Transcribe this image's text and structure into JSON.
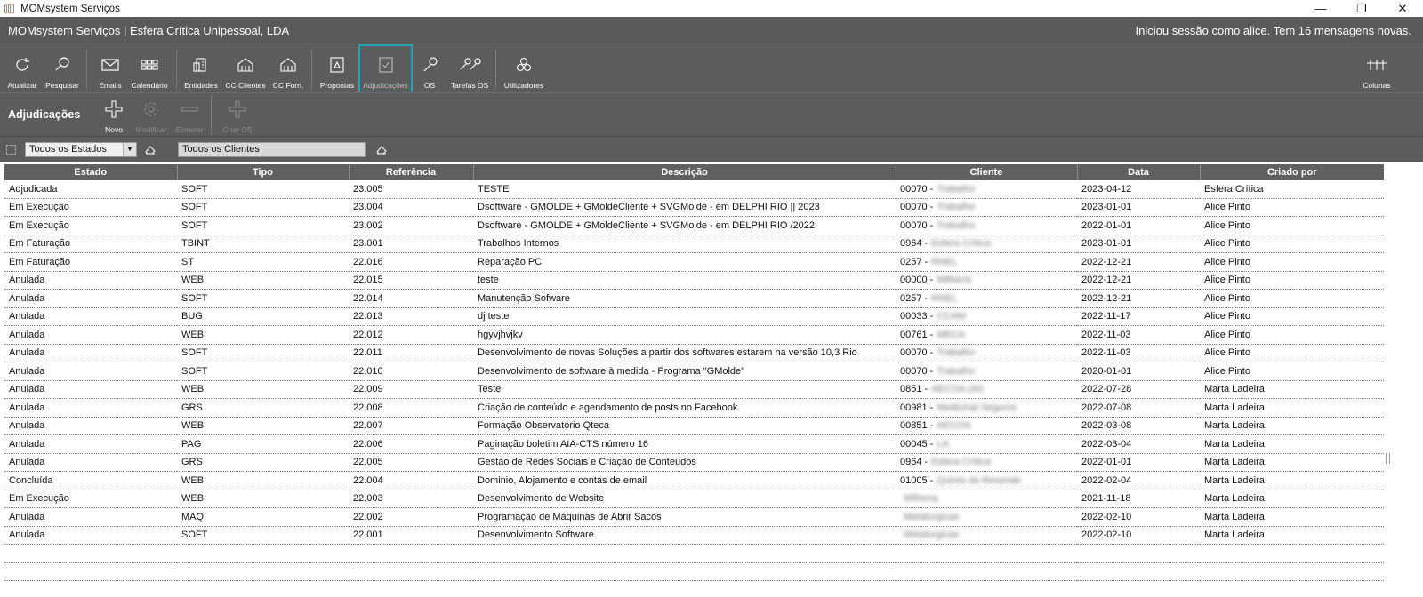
{
  "window": {
    "title": "MOMsystem Serviços",
    "minimize": "—",
    "maximize": "❐",
    "close": "✕"
  },
  "header": {
    "company": "MOMsystem Serviços | Esfera Crítica Unipessoal, LDA",
    "session": "Iniciou sessão como alice.  Tem 16 mensagens novas."
  },
  "toolbar": {
    "atualizar": "Atualizar",
    "pesquisar": "Pesquisar",
    "emails": "Emails",
    "calendario": "Calendário",
    "entidades": "Entidades",
    "cc_clientes": "CC Clientes",
    "cc_forn": "CC Forn.",
    "propostas": "Propostas",
    "adjudicacoes": "Adjudicações",
    "os": "OS",
    "tarefas_os": "Tarefas OS",
    "utilizadores": "Utilizadores",
    "colunas": "Colunas"
  },
  "section": {
    "title": "Adjudicações",
    "novo": "Novo",
    "modificar": "Modificar",
    "eliminar": "Eliminar",
    "criar_os": "Criar OS"
  },
  "filters": {
    "estados": "Todos os Estados",
    "clientes": "Todos os Clientes"
  },
  "table": {
    "columns": [
      "Estado",
      "Tipo",
      "Referência",
      "Descrição",
      "Cliente",
      "Data",
      "Criado por"
    ],
    "rows": [
      {
        "estado": "Adjudicada",
        "tipo": "SOFT",
        "ref": "23.005",
        "desc": "TESTE",
        "cli_code": "00070 -",
        "cli_name": "Trabalho",
        "data": "2023-04-12",
        "criado": "Esfera Crítica"
      },
      {
        "estado": "Em Execução",
        "tipo": "SOFT",
        "ref": "23.004",
        "desc": "Dsoftware - GMOLDE + GMoldeCliente + SVGMolde - em DELPHI RIO || 2023",
        "cli_code": "00070 -",
        "cli_name": "Trabalho",
        "data": "2023-01-01",
        "criado": "Alice Pinto"
      },
      {
        "estado": "Em Execução",
        "tipo": "SOFT",
        "ref": "23.002",
        "desc": "Dsoftware - GMOLDE + GMoldeCliente + SVGMolde - em DELPHI RIO /2022",
        "cli_code": "00070 -",
        "cli_name": "Trabalho",
        "data": "2022-01-01",
        "criado": "Alice Pinto"
      },
      {
        "estado": "Em Faturação",
        "tipo": "TBINT",
        "ref": "23.001",
        "desc": "Trabalhos Internos",
        "cli_code": "0964 -",
        "cli_name": "Esfera Crítica",
        "data": "2023-01-01",
        "criado": "Alice Pinto"
      },
      {
        "estado": "Em Faturação",
        "tipo": "ST",
        "ref": "22.016",
        "desc": "Reparação PC",
        "cli_code": "0257 -",
        "cli_name": "RNEL",
        "data": "2022-12-21",
        "criado": "Alice Pinto"
      },
      {
        "estado": "Anulada",
        "tipo": "WEB",
        "ref": "22.015",
        "desc": "teste",
        "cli_code": "00000 -",
        "cli_name": "Milhena",
        "data": "2022-12-21",
        "criado": "Alice Pinto"
      },
      {
        "estado": "Anulada",
        "tipo": "SOFT",
        "ref": "22.014",
        "desc": "Manutenção Sofware",
        "cli_code": "0257 -",
        "cli_name": "RNEL",
        "data": "2022-12-21",
        "criado": "Alice Pinto"
      },
      {
        "estado": "Anulada",
        "tipo": "BUG",
        "ref": "22.013",
        "desc": "dj teste",
        "cli_code": "00033 -",
        "cli_name": "CCAM",
        "data": "2022-11-17",
        "criado": "Alice Pinto"
      },
      {
        "estado": "Anulada",
        "tipo": "WEB",
        "ref": "22.012",
        "desc": "hgyvjhvjkv",
        "cli_code": "00761 -",
        "cli_name": "MECA",
        "data": "2022-11-03",
        "criado": "Alice Pinto"
      },
      {
        "estado": "Anulada",
        "tipo": "SOFT",
        "ref": "22.011",
        "desc": "Desenvolvimento de novas Soluções a partir dos softwares estarem na versão 10,3 Rio",
        "cli_code": "00070 -",
        "cli_name": "Trabalho",
        "data": "2022-11-03",
        "criado": "Alice Pinto"
      },
      {
        "estado": "Anulada",
        "tipo": "SOFT",
        "ref": "22.010",
        "desc": "Desenvolvimento de software à medida - Programa \"GMolde\"",
        "cli_code": "00070 -",
        "cli_name": "Trabalho",
        "data": "2020-01-01",
        "criado": "Alice Pinto"
      },
      {
        "estado": "Anulada",
        "tipo": "WEB",
        "ref": "22.009",
        "desc": "Teste",
        "cli_code": "0851 -",
        "cli_name": "AECOA (AI)",
        "data": "2022-07-28",
        "criado": "Marta Ladeira"
      },
      {
        "estado": "Anulada",
        "tipo": "GRS",
        "ref": "22.008",
        "desc": "Criação de conteúdo e agendamento de posts no Facebook",
        "cli_code": "00981 -",
        "cli_name": "Medicinal Seguros",
        "data": "2022-07-08",
        "criado": "Marta Ladeira"
      },
      {
        "estado": "Anulada",
        "tipo": "WEB",
        "ref": "22.007",
        "desc": "Formação Observatório Qteca",
        "cli_code": "00851 -",
        "cli_name": "AECOA",
        "data": "2022-03-08",
        "criado": "Marta Ladeira"
      },
      {
        "estado": "Anulada",
        "tipo": "PAG",
        "ref": "22.006",
        "desc": "Paginação boletim AIA-CTS número 16",
        "cli_code": "00045 -",
        "cli_name": "LA",
        "data": "2022-03-04",
        "criado": "Marta Ladeira"
      },
      {
        "estado": "Anulada",
        "tipo": "GRS",
        "ref": "22.005",
        "desc": "Gestão de Redes Sociais e Criação de Conteúdos",
        "cli_code": "0964 -",
        "cli_name": "Esfera Crítica",
        "data": "2022-01-01",
        "criado": "Marta Ladeira"
      },
      {
        "estado": "Concluída",
        "tipo": "WEB",
        "ref": "22.004",
        "desc": "Dominio,  Alojamento e contas de email",
        "cli_code": "01005 -",
        "cli_name": "Quinta da Resende",
        "data": "2022-02-04",
        "criado": "Marta Ladeira"
      },
      {
        "estado": "Em Execução",
        "tipo": "WEB",
        "ref": "22.003",
        "desc": "Desenvolvimento de Website",
        "cli_code": "",
        "cli_name": "Milhena",
        "data": "2021-11-18",
        "criado": "Marta Ladeira"
      },
      {
        "estado": "Anulada",
        "tipo": "MAQ",
        "ref": "22.002",
        "desc": "Programação de Máquinas de Abrir Sacos",
        "cli_code": "",
        "cli_name": "Metalurgicas",
        "data": "2022-02-10",
        "criado": "Marta Ladeira"
      },
      {
        "estado": "Anulada",
        "tipo": "SOFT",
        "ref": "22.001",
        "desc": "Desenvolvimento Software",
        "cli_code": "",
        "cli_name": "Metalurgicas",
        "data": "2022-02-10",
        "criado": "Marta Ladeira"
      }
    ]
  }
}
